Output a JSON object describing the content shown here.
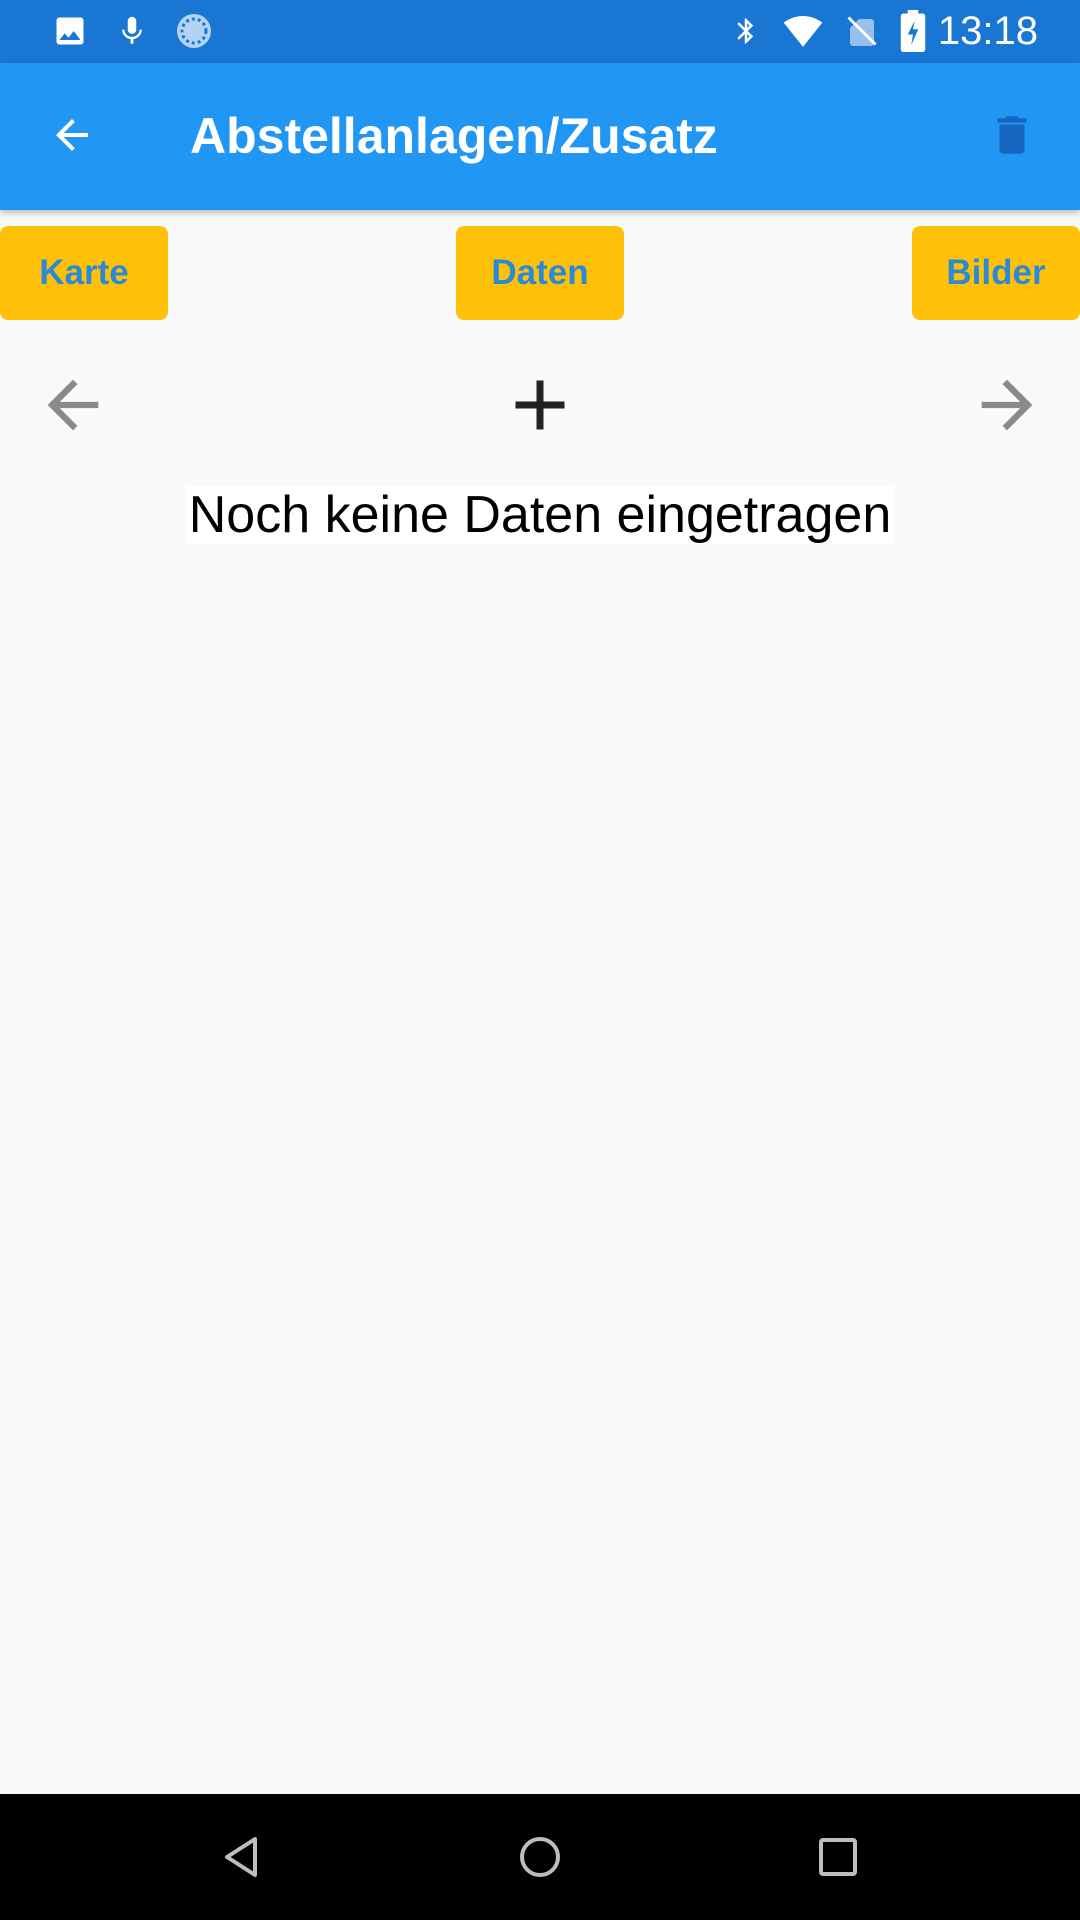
{
  "status_bar": {
    "time": "13:18",
    "icons": [
      "image-notification-icon",
      "mic-icon",
      "sync-icon",
      "bluetooth-icon",
      "wifi-icon",
      "no-sim-icon",
      "battery-charging-icon"
    ],
    "background": "#1976d2"
  },
  "app_bar": {
    "title": "Abstellanlagen/Zusatz",
    "back_icon": "arrow-back-icon",
    "delete_icon": "delete-icon",
    "background": "#2196f3"
  },
  "tabs": [
    {
      "label": "Karte"
    },
    {
      "label": "Daten"
    },
    {
      "label": "Bilder"
    }
  ],
  "tab_colors": {
    "background": "#ffc107",
    "text": "#2b8ad6"
  },
  "record_nav": {
    "prev_icon": "arrow-left-icon",
    "add_icon": "plus-icon",
    "next_icon": "arrow-right-icon"
  },
  "content": {
    "empty_message": "Noch keine Daten eingetragen"
  },
  "system_nav": {
    "buttons": [
      "back-triangle-icon",
      "home-circle-icon",
      "recents-square-icon"
    ]
  }
}
